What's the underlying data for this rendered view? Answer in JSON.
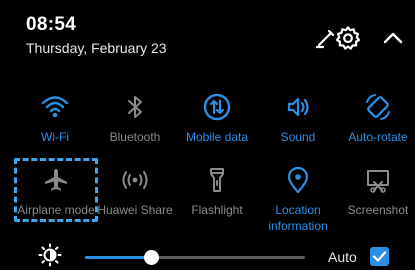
{
  "header": {
    "time": "08:54",
    "date": "Thursday, February 23",
    "icons": [
      "edit-icon",
      "settings-gear-icon",
      "collapse-chevron-icon"
    ]
  },
  "tiles": [
    {
      "label": "Wi-Fi",
      "icon": "wifi-icon",
      "active": true
    },
    {
      "label": "Bluetooth",
      "icon": "bluetooth-icon",
      "active": false
    },
    {
      "label": "Mobile data",
      "icon": "mobile-data-icon",
      "active": true
    },
    {
      "label": "Sound",
      "icon": "sound-icon",
      "active": true
    },
    {
      "label": "Auto-rotate",
      "icon": "auto-rotate-icon",
      "active": true
    },
    {
      "label": "Airplane mode",
      "icon": "airplane-icon",
      "active": false
    },
    {
      "label": "Huawei Share",
      "icon": "huawei-share-icon",
      "active": false
    },
    {
      "label": "Flashlight",
      "icon": "flashlight-icon",
      "active": false
    },
    {
      "label": "Location",
      "label2": "information",
      "icon": "location-icon",
      "active": true
    },
    {
      "label": "Screenshot",
      "icon": "screenshot-icon",
      "active": false
    }
  ],
  "brightness": {
    "icon": "brightness-icon",
    "level": 0.3,
    "auto_label": "Auto",
    "auto_checked": true
  },
  "colors": {
    "accent": "#2c8fe6",
    "inactive": "#8a8a8a",
    "background": "#000000",
    "highlight": "#3ea7ea"
  }
}
